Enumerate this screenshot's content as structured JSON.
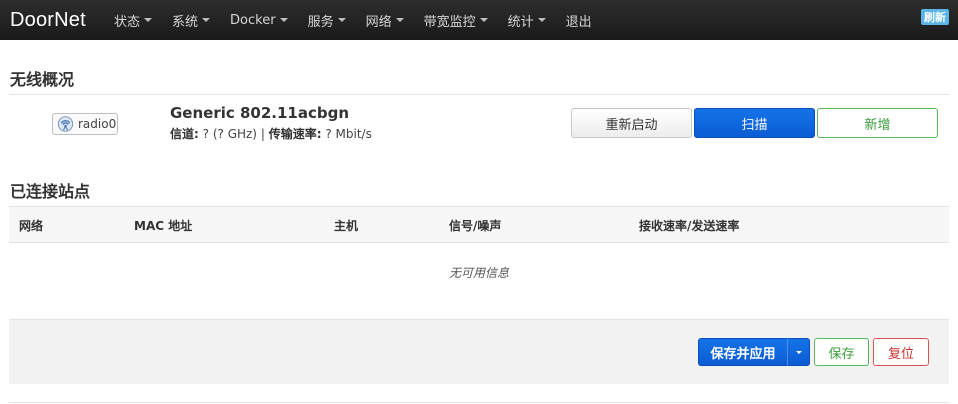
{
  "brand": "DoorNet",
  "nav": {
    "items": [
      {
        "label": "状态",
        "dropdown": true
      },
      {
        "label": "系统",
        "dropdown": true
      },
      {
        "label": "Docker",
        "dropdown": true
      },
      {
        "label": "服务",
        "dropdown": true
      },
      {
        "label": "网络",
        "dropdown": true
      },
      {
        "label": "带宽监控",
        "dropdown": true
      },
      {
        "label": "统计",
        "dropdown": true
      },
      {
        "label": "退出",
        "dropdown": false
      }
    ],
    "refresh_label": "刷新"
  },
  "wireless": {
    "title": "无线概况",
    "radio": {
      "name": "radio0",
      "icon": "wifi-antenna-icon",
      "model": "Generic 802.11acbgn",
      "channel_label": "信道:",
      "channel_value": "? (? GHz)",
      "separator": "|",
      "rate_label": "传输速率:",
      "rate_value": "? Mbit/s"
    },
    "buttons": {
      "restart": "重新启动",
      "scan": "扫描",
      "add": "新增"
    }
  },
  "stations": {
    "title": "已连接站点",
    "columns": [
      "网络",
      "MAC 地址",
      "主机",
      "信号/噪声",
      "接收速率/发送速率"
    ],
    "empty_message": "无可用信息"
  },
  "actions": {
    "save_apply": "保存并应用",
    "save": "保存",
    "reset": "复位"
  },
  "colors": {
    "navbar": "#1f1f1f",
    "primary": "#0b5cd4",
    "success": "#5cb85c",
    "danger": "#d9534f",
    "badge": "#5ab5e6"
  }
}
